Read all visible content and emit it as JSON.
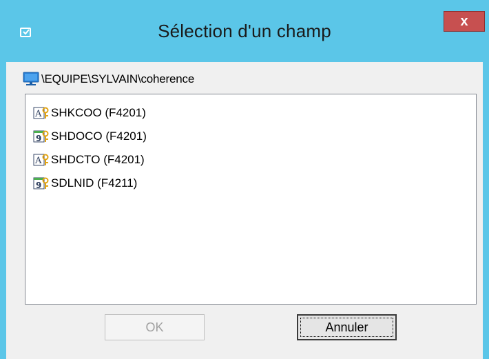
{
  "window": {
    "title": "Sélection d'un champ",
    "close_label": "x",
    "app_icon": "checkbox-app-icon"
  },
  "path": {
    "icon": "computer-icon",
    "text": "\\EQUIPE\\SYLVAIN\\coherence"
  },
  "fields": [
    {
      "label": "SHKCOO (F4201)",
      "type": "text-key",
      "icon": "alpha-key-field-icon"
    },
    {
      "label": "SHDOCO (F4201)",
      "type": "numeric-key",
      "icon": "numeric-key-field-icon"
    },
    {
      "label": "SHDCTO (F4201)",
      "type": "text-key",
      "icon": "alpha-key-field-icon"
    },
    {
      "label": "SDLNID (F4211)",
      "type": "numeric-key",
      "icon": "numeric-key-field-icon"
    }
  ],
  "buttons": {
    "ok_label": "OK",
    "ok_enabled": false,
    "cancel_label": "Annuler"
  },
  "colors": {
    "titlebar": "#5bc6e8",
    "close": "#c75050",
    "dialog_bg": "#f0f0f0"
  }
}
